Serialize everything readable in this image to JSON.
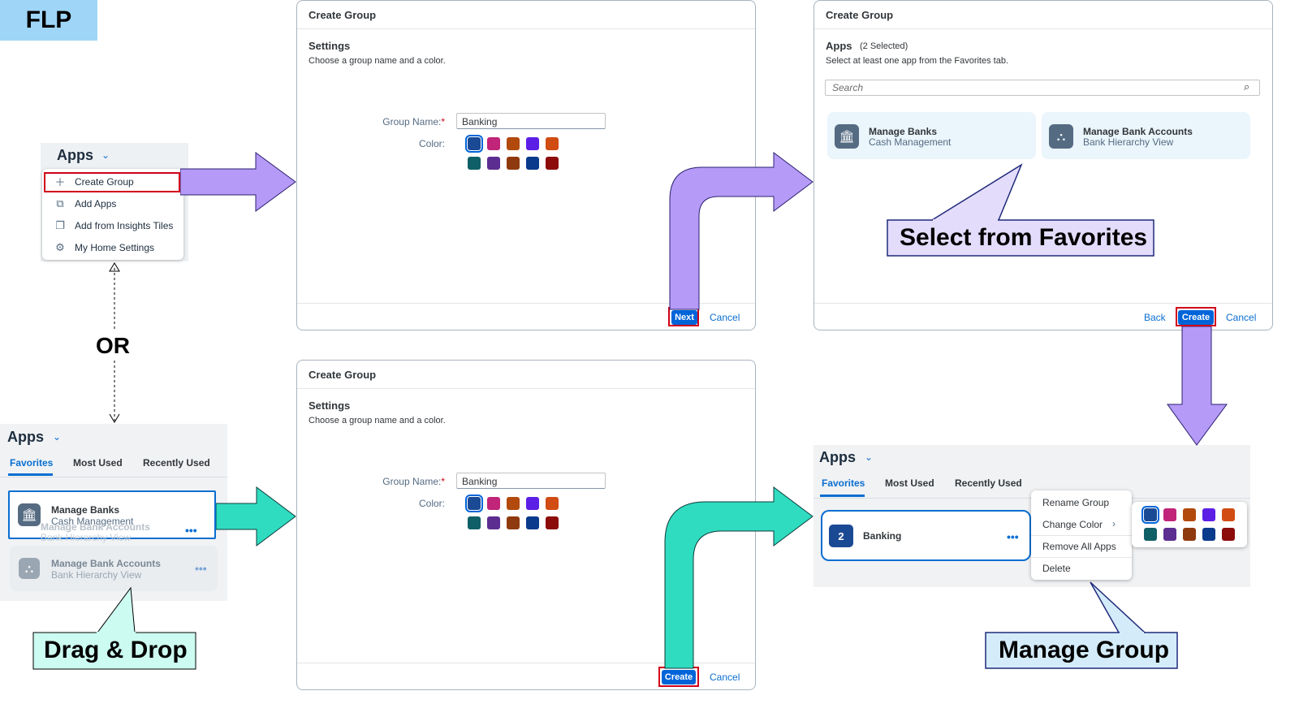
{
  "flp_label": "FLP",
  "or_label": "OR",
  "apps_menu": {
    "title": "Apps",
    "items": [
      "Create Group",
      "Add Apps",
      "Add from Insights Tiles",
      "My Home Settings"
    ]
  },
  "dialog_settings": {
    "title": "Create Group",
    "section": "Settings",
    "subtitle": "Choose a group name and a color.",
    "group_name_label": "Group Name:",
    "required_mark": "*",
    "group_name_value": "Banking",
    "color_label": "Color:",
    "next_label": "Next",
    "create_label": "Create",
    "cancel_label": "Cancel"
  },
  "dialog_apps": {
    "title": "Create Group",
    "section": "Apps",
    "selected_count": "(2 Selected)",
    "subtitle": "Select at least one app from the Favorites tab.",
    "search_placeholder": "Search",
    "back_label": "Back",
    "create_label": "Create",
    "cancel_label": "Cancel"
  },
  "apps": [
    {
      "title": "Manage Banks",
      "subtitle": "Cash Management",
      "icon": "bank-icon"
    },
    {
      "title": "Manage Bank Accounts",
      "subtitle": "Bank Hierarchy View",
      "icon": "hierarchy-icon"
    }
  ],
  "tabs": [
    "Favorites",
    "Most Used",
    "Recently Used"
  ],
  "manage_group": {
    "apps_title": "Apps",
    "group_count": "2",
    "group_name": "Banking",
    "context_menu": [
      "Rename Group",
      "Change Color",
      "Remove All Apps",
      "Delete"
    ]
  },
  "callouts": {
    "select_favorites": "Select from Favorites",
    "drag_drop": "Drag & Drop",
    "manage_group": "Manage Group"
  },
  "colors": {
    "palette": [
      "#1b4a94",
      "#c0257a",
      "#b24a0e",
      "#5c1fe6",
      "#d14c12",
      "#0f5f66",
      "#5c2e91",
      "#8f3a0e",
      "#0a3a8c",
      "#8c0c0c"
    ],
    "accent": "#0064d9",
    "highlight": "#d0021b",
    "purple_arrow": "#b69af7",
    "teal_arrow": "#2fdcc0"
  }
}
